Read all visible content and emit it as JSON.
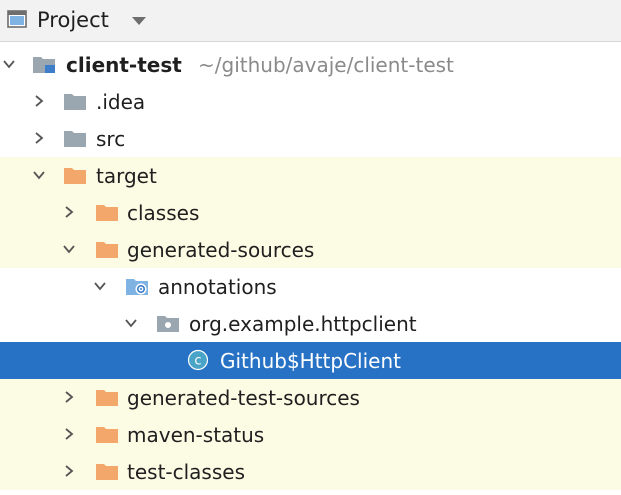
{
  "header": {
    "title": "Project",
    "window_icon": "project-window-icon",
    "dropdown_icon": "chevron-down-icon"
  },
  "colors": {
    "selection": "#2772c5",
    "excluded_background": "#fcfbe4",
    "orange_folder": "#f4a76a",
    "gray_folder": "#9aa7b0",
    "path_text": "#8a8a8a"
  },
  "tree": {
    "root": {
      "label": "client-test",
      "path": "~/github/avaje/client-test",
      "expanded": true,
      "icon": "module-folder-icon"
    },
    "idea": {
      "label": ".idea",
      "expanded": false,
      "icon": "folder-icon"
    },
    "src": {
      "label": "src",
      "expanded": false,
      "icon": "folder-icon"
    },
    "target": {
      "label": "target",
      "expanded": true,
      "icon": "excluded-folder-icon"
    },
    "classes": {
      "label": "classes",
      "expanded": false,
      "icon": "excluded-folder-icon"
    },
    "generated_sources": {
      "label": "generated-sources",
      "expanded": true,
      "icon": "excluded-folder-icon"
    },
    "annotations": {
      "label": "annotations",
      "expanded": true,
      "icon": "generated-sources-root-icon"
    },
    "package": {
      "label": "org.example.httpclient",
      "expanded": true,
      "icon": "package-icon"
    },
    "class_file": {
      "label": "Github$HttpClient",
      "selected": true,
      "icon": "class-icon",
      "icon_letter": "c"
    },
    "generated_test_sources": {
      "label": "generated-test-sources",
      "expanded": false,
      "icon": "excluded-folder-icon"
    },
    "maven_status": {
      "label": "maven-status",
      "expanded": false,
      "icon": "excluded-folder-icon"
    },
    "test_classes": {
      "label": "test-classes",
      "expanded": false,
      "icon": "excluded-folder-icon"
    }
  }
}
